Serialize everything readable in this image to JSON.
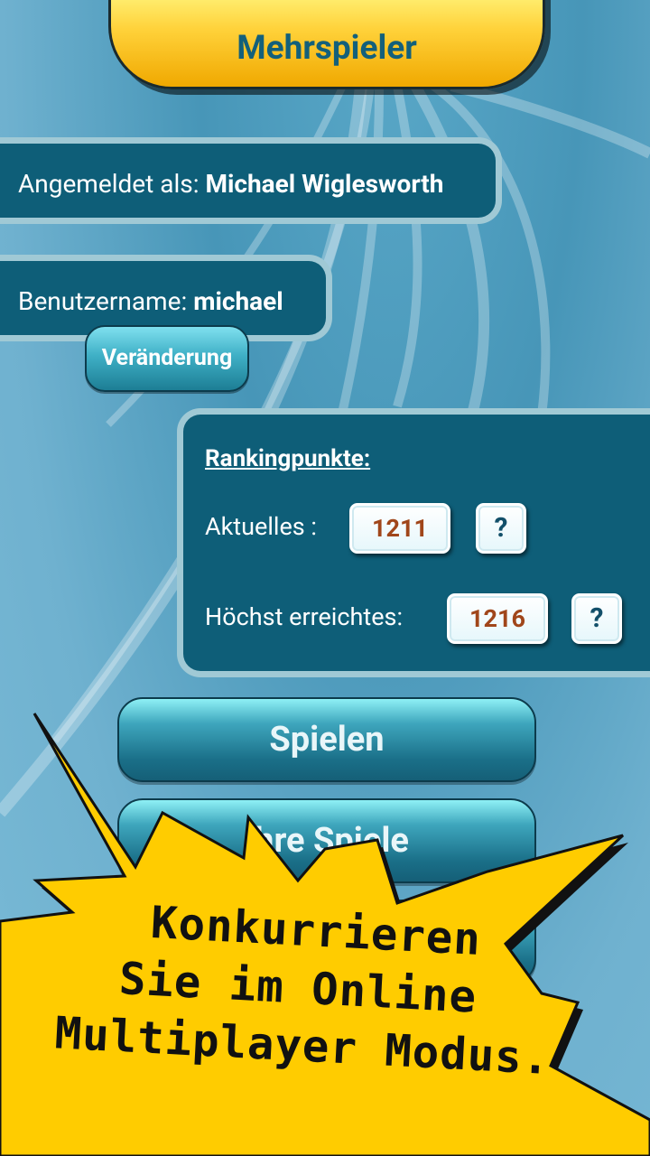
{
  "header": {
    "title": "Mehrspieler"
  },
  "account": {
    "logged_in_label": "Angemeldet als:",
    "logged_in_name": "Michael Wiglesworth",
    "username_label": "Benutzername:",
    "username_value": "michael",
    "change_button": "Veränderung"
  },
  "ranking": {
    "title": "Rankingpunkte:",
    "current_label": "Aktuelles :",
    "current_value": "1211",
    "best_label": "Höchst erreichtes:",
    "best_value": "1216",
    "help_symbol": "?"
  },
  "menu": {
    "play_button": "Spielen",
    "games_button": "Ihre Spiele"
  },
  "promo": {
    "lines": [
      "Konkurrieren",
      "Sie im Online",
      "Multiplayer Modus."
    ]
  },
  "colors": {
    "accent_yellow": "#ffcc00",
    "panel_blue": "#0e5e78",
    "value_brown": "#a0461a",
    "title_blue": "#13607b"
  }
}
